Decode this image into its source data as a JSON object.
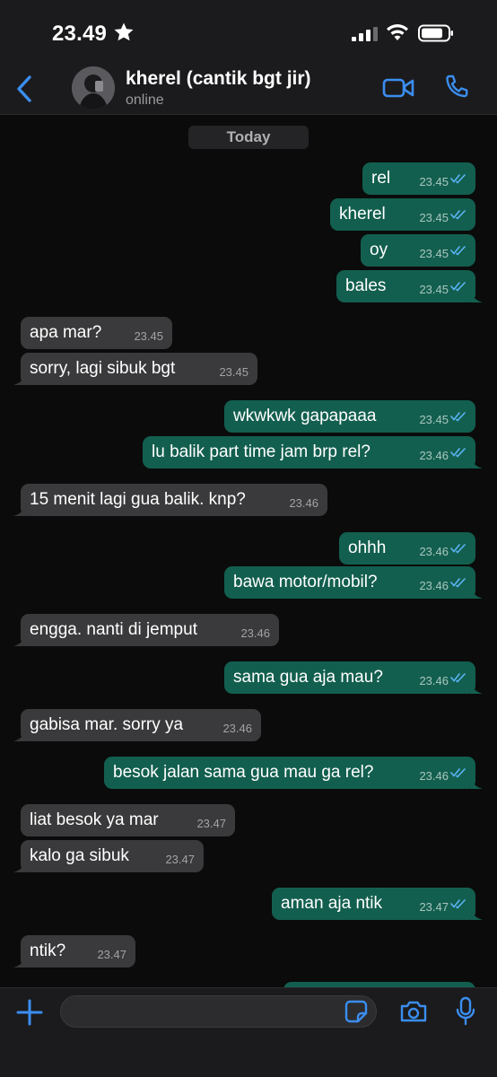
{
  "status_bar": {
    "time": "23.49"
  },
  "header": {
    "contact_name": "kherel (cantik bgt jir)",
    "contact_status": "online"
  },
  "chat": {
    "day_label": "Today",
    "messages": [
      {
        "dir": "out",
        "text": "rel",
        "time": "23.45"
      },
      {
        "dir": "out",
        "text": "kherel",
        "time": "23.45"
      },
      {
        "dir": "out",
        "text": "oy",
        "time": "23.45"
      },
      {
        "dir": "out",
        "text": "bales",
        "time": "23.45"
      },
      {
        "dir": "in",
        "text": "apa mar?",
        "time": "23.45"
      },
      {
        "dir": "in",
        "text": "sorry, lagi sibuk bgt",
        "time": "23.45"
      },
      {
        "dir": "out",
        "text": "wkwkwk gapapaaa",
        "time": "23.45"
      },
      {
        "dir": "out",
        "text": "lu balik part time jam brp rel?",
        "time": "23.46"
      },
      {
        "dir": "in",
        "text": "15 menit lagi gua balik. knp?",
        "time": "23.46"
      },
      {
        "dir": "out",
        "text": "ohhh",
        "time": "23.46"
      },
      {
        "dir": "out",
        "text": "bawa motor/mobil?",
        "time": "23.46"
      },
      {
        "dir": "in",
        "text": "engga. nanti di jemput",
        "time": "23.46"
      },
      {
        "dir": "out",
        "text": "sama gua aja mau?",
        "time": "23.46"
      },
      {
        "dir": "in",
        "text": "gabisa mar. sorry ya",
        "time": "23.46"
      },
      {
        "dir": "out",
        "text": "besok jalan sama gua mau ga rel?",
        "time": "23.46"
      },
      {
        "dir": "in",
        "text": "liat besok ya mar",
        "time": "23.47"
      },
      {
        "dir": "in",
        "text": "kalo ga sibuk",
        "time": "23.47"
      },
      {
        "dir": "out",
        "text": "aman aja ntik",
        "time": "23.47"
      },
      {
        "dir": "in",
        "text": "ntik?",
        "time": "23.47"
      }
    ]
  },
  "colors": {
    "outgoing_bubble": "#135f4f",
    "incoming_bubble": "#3a3a3c",
    "accent": "#3b8ef0",
    "read_tick": "#5ab4f5"
  }
}
